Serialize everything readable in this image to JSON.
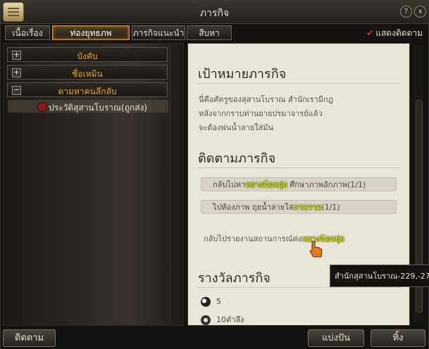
{
  "window": {
    "title": "ภารกิจ",
    "help": "?",
    "close": "x"
  },
  "tabs": [
    "เนื้อเรื่อง",
    "ท่องยุทธภพ",
    "ภารกิจแนะนำ",
    "สืบหาปริศนา"
  ],
  "show_tracking": "แสดงติดตาม",
  "categories": [
    {
      "label": "บังคับ",
      "toggle": "+"
    },
    {
      "label": "ชื่อเหมิน",
      "toggle": "+"
    },
    {
      "label": "ตามหาคนลึกลับ",
      "toggle": "−"
    }
  ],
  "selected_quest": "ประวัติสุสานโบราณ(ถูกส่ง)",
  "detail": {
    "goal_heading": "เป้าหมายภารกิจ",
    "goal_lines": [
      "นี่คือศัตรูของสุสานโบราณ สำนักเรามีกฎ",
      "หลังจากกราบท่านยายปรมาจารย์แล้ว",
      "จะต้องพ่นน้ำลายใส่มัน"
    ],
    "tracking_heading": "ติดตามภารกิจ",
    "track1": {
      "pre": "กลับไปหา",
      "name": "หยางฉือหยุ่ย",
      "post": " ศึกษาภาพอักภาพ(1/1)"
    },
    "track2": {
      "pre": "ไปห้องภาพ ถุยน้ำลายใส่",
      "name": "ภาพวาด",
      "post": "(1/1)"
    },
    "report": {
      "pre": "กลับไปรายงานสถานการณ์ต่อ",
      "name": "หยางฉือหยุ่ย"
    },
    "reward_heading": "รางวัลภารกิจ",
    "rewards": [
      {
        "icon": "yin-yang-icon",
        "value": "5"
      },
      {
        "icon": "coins-icon",
        "value": "10ตำลึง"
      }
    ]
  },
  "tooltip": "สำนักสุสานโบราณ-229,-27",
  "buttons": {
    "track": "ติดตาม",
    "share": "แบ่งปัน",
    "abandon": "ทิ้ง"
  }
}
